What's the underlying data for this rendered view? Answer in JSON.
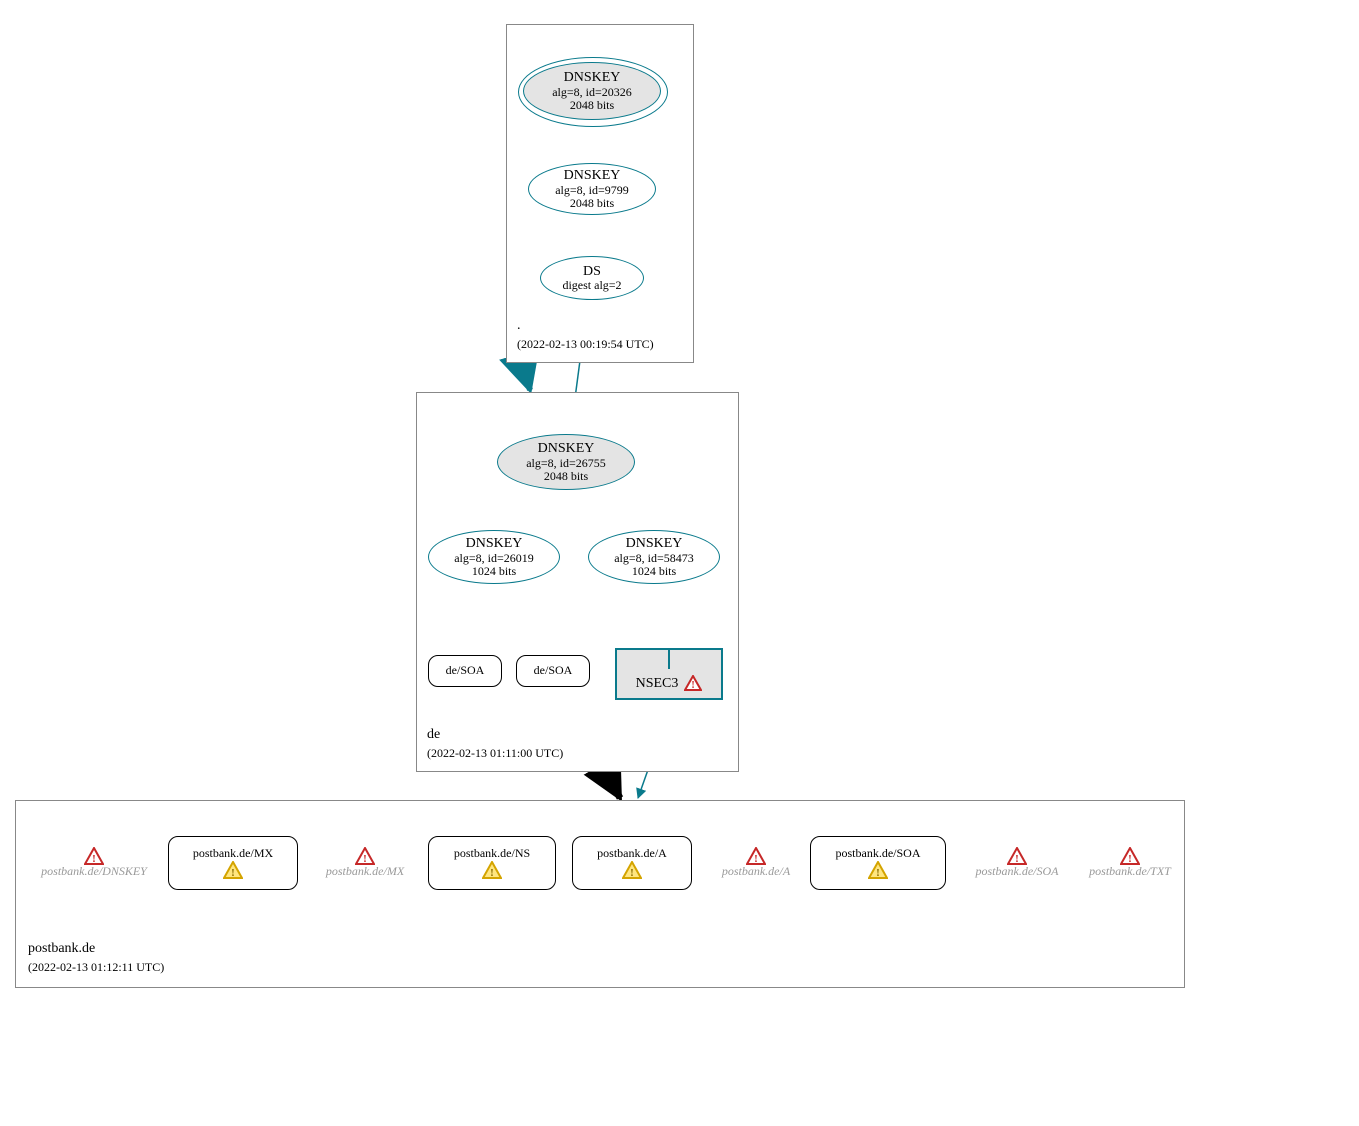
{
  "diagram_type": "DNSSEC authentication graph",
  "zones": {
    "root": {
      "label": ".",
      "timestamp": "(2022-02-13 00:19:54 UTC)"
    },
    "de": {
      "label": "de",
      "timestamp": "(2022-02-13 01:11:00 UTC)"
    },
    "leaf": {
      "label": "postbank.de",
      "timestamp": "(2022-02-13 01:12:11 UTC)"
    }
  },
  "root_nodes": {
    "ksk": {
      "title": "DNSKEY",
      "line2": "alg=8, id=20326",
      "line3": "2048 bits"
    },
    "zsk": {
      "title": "DNSKEY",
      "line2": "alg=8, id=9799",
      "line3": "2048 bits"
    },
    "ds": {
      "title": "DS",
      "line2": "digest alg=2"
    }
  },
  "de_nodes": {
    "ksk": {
      "title": "DNSKEY",
      "line2": "alg=8, id=26755",
      "line3": "2048 bits"
    },
    "zsk1": {
      "title": "DNSKEY",
      "line2": "alg=8, id=26019",
      "line3": "1024 bits"
    },
    "zsk2": {
      "title": "DNSKEY",
      "line2": "alg=8, id=58473",
      "line3": "1024 bits"
    },
    "soa1": {
      "label": "de/SOA"
    },
    "soa2": {
      "label": "de/SOA"
    },
    "nsec3": {
      "label": "NSEC3"
    }
  },
  "leaf_nodes": {
    "dnskey_err": {
      "label": "postbank.de/DNSKEY"
    },
    "mx_warn": {
      "label": "postbank.de/MX"
    },
    "mx_err": {
      "label": "postbank.de/MX"
    },
    "ns_warn": {
      "label": "postbank.de/NS"
    },
    "a_warn": {
      "label": "postbank.de/A"
    },
    "a_err": {
      "label": "postbank.de/A"
    },
    "soa_warn": {
      "label": "postbank.de/SOA"
    },
    "soa_err": {
      "label": "postbank.de/SOA"
    },
    "txt_err": {
      "label": "postbank.de/TXT"
    }
  },
  "status_legend": {
    "error_icon": "red triangle — error/bogus",
    "warn_icon": "yellow triangle — warning/insecure"
  },
  "edges": [
    {
      "from": "root.ksk",
      "to": "root.ksk",
      "kind": "self-loop"
    },
    {
      "from": "root.ksk",
      "to": "root.zsk"
    },
    {
      "from": "root.zsk",
      "to": "root.ds"
    },
    {
      "from": "root.ds",
      "to": "de.ksk"
    },
    {
      "from": "root",
      "to": "de",
      "kind": "delegation"
    },
    {
      "from": "de.ksk",
      "to": "de.ksk",
      "kind": "self-loop"
    },
    {
      "from": "de.ksk",
      "to": "de.zsk1"
    },
    {
      "from": "de.ksk",
      "to": "de.zsk2"
    },
    {
      "from": "de.zsk2",
      "to": "de.soa1"
    },
    {
      "from": "de.zsk2",
      "to": "de.soa2"
    },
    {
      "from": "de.zsk2",
      "to": "de.nsec3",
      "count": 3
    },
    {
      "from": "de.nsec3",
      "to": "leaf"
    },
    {
      "from": "de",
      "to": "leaf",
      "kind": "delegation"
    }
  ],
  "colors": {
    "teal": "#0a7a8c",
    "ksk_fill": "#e4e4e4",
    "error_red": "#c62828",
    "warn_yellow": "#f5c400"
  }
}
